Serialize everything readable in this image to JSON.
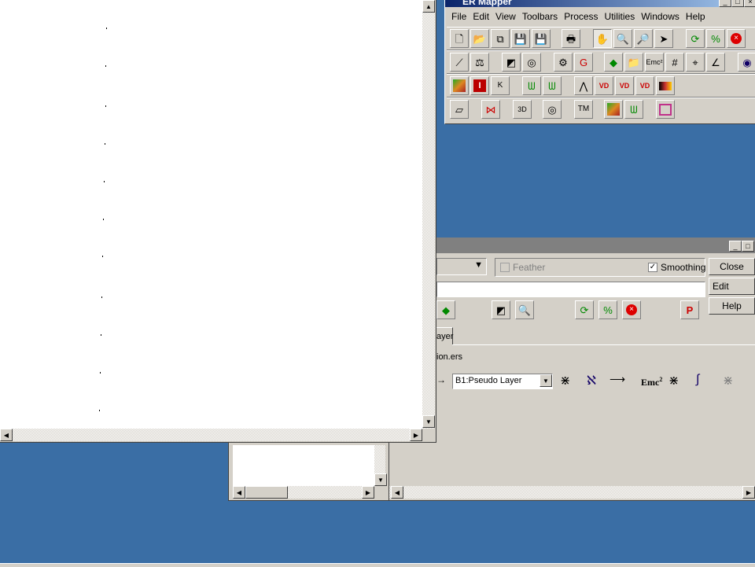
{
  "main_window": {
    "title": "ER Mapper",
    "menu": [
      "File",
      "Edit",
      "View",
      "Toolbars",
      "Process",
      "Utilities",
      "Windows",
      "Help"
    ],
    "toolbar_rows": [
      [
        "new-icon",
        "open-icon",
        "copy-icon",
        "save-icon",
        "save-as-icon",
        "print-icon",
        "pan-hand-icon",
        "zoom-icon",
        "zoom-box-icon",
        "pointer-icon",
        "refresh-icon",
        "percent-icon",
        "stop-icon"
      ],
      [
        "wand-icon",
        "balance-icon",
        "layer-edit-icon",
        "algorithm-icon",
        "process-icon",
        "geocode-icon",
        "layers-icon",
        "open-folder-icon",
        "formula-icon",
        "grid-icon",
        "crosshair-icon",
        "transform-icon",
        "globe-icon"
      ],
      [
        "image-icon",
        "info-icon",
        "k-icon",
        "filter-a-icon",
        "filter-b-icon",
        "histogram-icon",
        "vd-icon",
        "vd2-icon",
        "vd3-icon",
        "display-icon"
      ],
      [
        "annotation-icon",
        "bowtie-icon",
        "3d-icon",
        "mosaic-icon",
        "tm-icon",
        "image2-icon",
        "wave-icon",
        "frame-icon"
      ]
    ]
  },
  "algorithm_window": {
    "feather_label": "Feather",
    "feather_checked": false,
    "smoothing_label": "Smoothing",
    "smoothing_checked": true,
    "close_label": "Close",
    "edit_label": "Edit",
    "help_label": "Help",
    "tab_label": "ayer",
    "dataset_text": "ion.ers",
    "layer_select": "B1:Pseudo Layer",
    "formula_label": "Emc"
  },
  "colors": {
    "desktop": "#3a6ea5",
    "face": "#d4d0c8"
  }
}
